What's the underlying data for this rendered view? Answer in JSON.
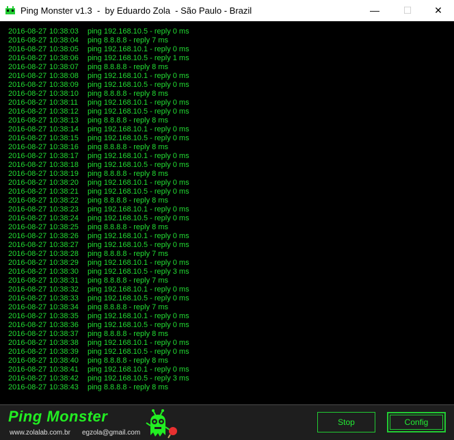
{
  "window": {
    "title": "Ping Monster v1.3  -  by Eduardo Zola  - São Paulo - Brazil",
    "minimize_glyph": "—",
    "maximize_glyph": "☐",
    "close_glyph": "✕"
  },
  "log": [
    {
      "date": "2016-08-27",
      "time": "10:38:03",
      "msg": "ping 192.168.10.5  -  reply 0 ms"
    },
    {
      "date": "2016-08-27",
      "time": "10:38:04",
      "msg": "ping 8.8.8.8  -  reply 7 ms"
    },
    {
      "date": "2016-08-27",
      "time": "10:38:05",
      "msg": "ping 192.168.10.1  -  reply 0 ms"
    },
    {
      "date": "2016-08-27",
      "time": "10:38:06",
      "msg": "ping 192.168.10.5  -  reply 1 ms"
    },
    {
      "date": "2016-08-27",
      "time": "10:38:07",
      "msg": "ping 8.8.8.8  -  reply 8 ms"
    },
    {
      "date": "2016-08-27",
      "time": "10:38:08",
      "msg": "ping 192.168.10.1  -  reply 0 ms"
    },
    {
      "date": "2016-08-27",
      "time": "10:38:09",
      "msg": "ping 192.168.10.5  -  reply 0 ms"
    },
    {
      "date": "2016-08-27",
      "time": "10:38:10",
      "msg": "ping 8.8.8.8  -  reply 8 ms"
    },
    {
      "date": "2016-08-27",
      "time": "10:38:11",
      "msg": "ping 192.168.10.1  -  reply 0 ms"
    },
    {
      "date": "2016-08-27",
      "time": "10:38:12",
      "msg": "ping 192.168.10.5  -  reply 0 ms"
    },
    {
      "date": "2016-08-27",
      "time": "10:38:13",
      "msg": "ping 8.8.8.8  -  reply 8 ms"
    },
    {
      "date": "2016-08-27",
      "time": "10:38:14",
      "msg": "ping 192.168.10.1  -  reply 0 ms"
    },
    {
      "date": "2016-08-27",
      "time": "10:38:15",
      "msg": "ping 192.168.10.5  -  reply 0 ms"
    },
    {
      "date": "2016-08-27",
      "time": "10:38:16",
      "msg": "ping 8.8.8.8  -  reply 8 ms"
    },
    {
      "date": "2016-08-27",
      "time": "10:38:17",
      "msg": "ping 192.168.10.1  -  reply 0 ms"
    },
    {
      "date": "2016-08-27",
      "time": "10:38:18",
      "msg": "ping 192.168.10.5  -  reply 0 ms"
    },
    {
      "date": "2016-08-27",
      "time": "10:38:19",
      "msg": "ping 8.8.8.8  -  reply 8 ms"
    },
    {
      "date": "2016-08-27",
      "time": "10:38:20",
      "msg": "ping 192.168.10.1  -  reply 0 ms"
    },
    {
      "date": "2016-08-27",
      "time": "10:38:21",
      "msg": "ping 192.168.10.5  -  reply 0 ms"
    },
    {
      "date": "2016-08-27",
      "time": "10:38:22",
      "msg": "ping 8.8.8.8  -  reply 8 ms"
    },
    {
      "date": "2016-08-27",
      "time": "10:38:23",
      "msg": "ping 192.168.10.1  -  reply 0 ms"
    },
    {
      "date": "2016-08-27",
      "time": "10:38:24",
      "msg": "ping 192.168.10.5  -  reply 0 ms"
    },
    {
      "date": "2016-08-27",
      "time": "10:38:25",
      "msg": "ping 8.8.8.8  -  reply 8 ms"
    },
    {
      "date": "2016-08-27",
      "time": "10:38:26",
      "msg": "ping 192.168.10.1  -  reply 0 ms"
    },
    {
      "date": "2016-08-27",
      "time": "10:38:27",
      "msg": "ping 192.168.10.5  -  reply 0 ms"
    },
    {
      "date": "2016-08-27",
      "time": "10:38:28",
      "msg": "ping 8.8.8.8  -  reply 7 ms"
    },
    {
      "date": "2016-08-27",
      "time": "10:38:29",
      "msg": "ping 192.168.10.1  -  reply 0 ms"
    },
    {
      "date": "2016-08-27",
      "time": "10:38:30",
      "msg": "ping 192.168.10.5  -  reply 3 ms"
    },
    {
      "date": "2016-08-27",
      "time": "10:38:31",
      "msg": "ping 8.8.8.8  -  reply 7 ms"
    },
    {
      "date": "2016-08-27",
      "time": "10:38:32",
      "msg": "ping 192.168.10.1  -  reply 0 ms"
    },
    {
      "date": "2016-08-27",
      "time": "10:38:33",
      "msg": "ping 192.168.10.5  -  reply 0 ms"
    },
    {
      "date": "2016-08-27",
      "time": "10:38:34",
      "msg": "ping 8.8.8.8  -  reply 7 ms"
    },
    {
      "date": "2016-08-27",
      "time": "10:38:35",
      "msg": "ping 192.168.10.1  -  reply 0 ms"
    },
    {
      "date": "2016-08-27",
      "time": "10:38:36",
      "msg": "ping 192.168.10.5  -  reply 0 ms"
    },
    {
      "date": "2016-08-27",
      "time": "10:38:37",
      "msg": "ping 8.8.8.8  -  reply 8 ms"
    },
    {
      "date": "2016-08-27",
      "time": "10:38:38",
      "msg": "ping 192.168.10.1  -  reply 0 ms"
    },
    {
      "date": "2016-08-27",
      "time": "10:38:39",
      "msg": "ping 192.168.10.5  -  reply 0 ms"
    },
    {
      "date": "2016-08-27",
      "time": "10:38:40",
      "msg": "ping 8.8.8.8  -  reply 8 ms"
    },
    {
      "date": "2016-08-27",
      "time": "10:38:41",
      "msg": "ping 192.168.10.1  -  reply 0 ms"
    },
    {
      "date": "2016-08-27",
      "time": "10:38:42",
      "msg": "ping 192.168.10.5  -  reply 3 ms"
    },
    {
      "date": "2016-08-27",
      "time": "10:38:43",
      "msg": "ping 8.8.8.8  -  reply 8 ms"
    }
  ],
  "footer": {
    "logo_text": "Ping Monster",
    "website": "www.zolalab.com.br",
    "email": "egzola@gmail.com",
    "stop_label": "Stop",
    "config_label": "Config"
  },
  "colors": {
    "log_text": "#22dd33",
    "accent": "#22cc33",
    "background": "#000000",
    "footer_bg": "#1e1e1e"
  },
  "icons": {
    "app": "monster-app-icon",
    "mascot": "monster-mascot-icon"
  }
}
